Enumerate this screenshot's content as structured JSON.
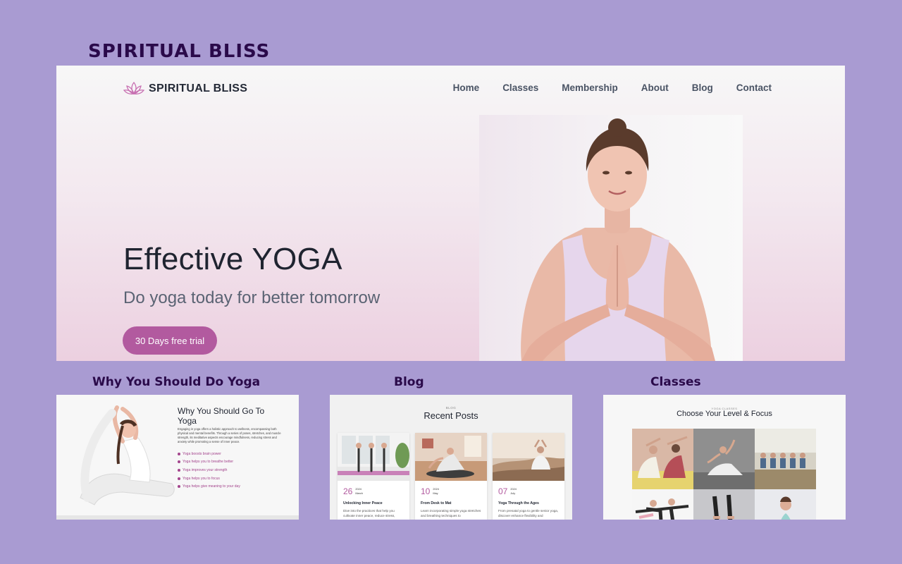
{
  "showcase": {
    "title": "SPIRITUAL BLISS",
    "captions": [
      "Why You Should Do Yoga",
      "Blog",
      "Classes"
    ]
  },
  "colors": {
    "background": "#a99bd2",
    "accent": "#b25a9f",
    "heading": "#2a0a4a"
  },
  "hero": {
    "brand": "SPIRITUAL BLISS",
    "brand_icon": "lotus-icon",
    "nav": [
      "Home",
      "Classes",
      "Membership",
      "About",
      "Blog",
      "Contact"
    ],
    "headline": "Effective YOGA",
    "subheadline": "Do yoga today for better tomorrow",
    "cta": "30 Days free trial"
  },
  "why": {
    "title": "Why You Should Go To Yoga",
    "body": "Engaging in yoga offers a holistic approach to wellness, encompassing both physical and mental benefits. Through a series of poses, stretches, and muscle strength, its meditative aspects encourage mindfulness, reducing stress and anxiety while promoting a sense of inner peace.",
    "benefits": [
      "Yoga boosts brain power",
      "Yoga helps you to breathe better",
      "Yoga improves your strength",
      "Yoga helps you to focus",
      "Yoga helps give meaning to your day"
    ]
  },
  "blog": {
    "eyebrow": "BLOG",
    "title": "Recent Posts",
    "posts": [
      {
        "day": "26",
        "year": "2024",
        "month": "March",
        "title": "Unlocking Inner Peace",
        "excerpt": "Dive into the practices that help you cultivate inner peace, reduce stress,"
      },
      {
        "day": "10",
        "year": "2024",
        "month": "May",
        "title": "From Desk to Mat",
        "excerpt": "Learn incorporating simple yoga stretches and breathing techniques to"
      },
      {
        "day": "07",
        "year": "2024",
        "month": "July",
        "title": "Yoga Through the Ages",
        "excerpt": "From prenatal yoga to gentle senior yoga, discover enhance flexibility and"
      }
    ]
  },
  "classes": {
    "eyebrow": "YOGA CLASSES",
    "title": "Choose Your Level & Focus"
  }
}
